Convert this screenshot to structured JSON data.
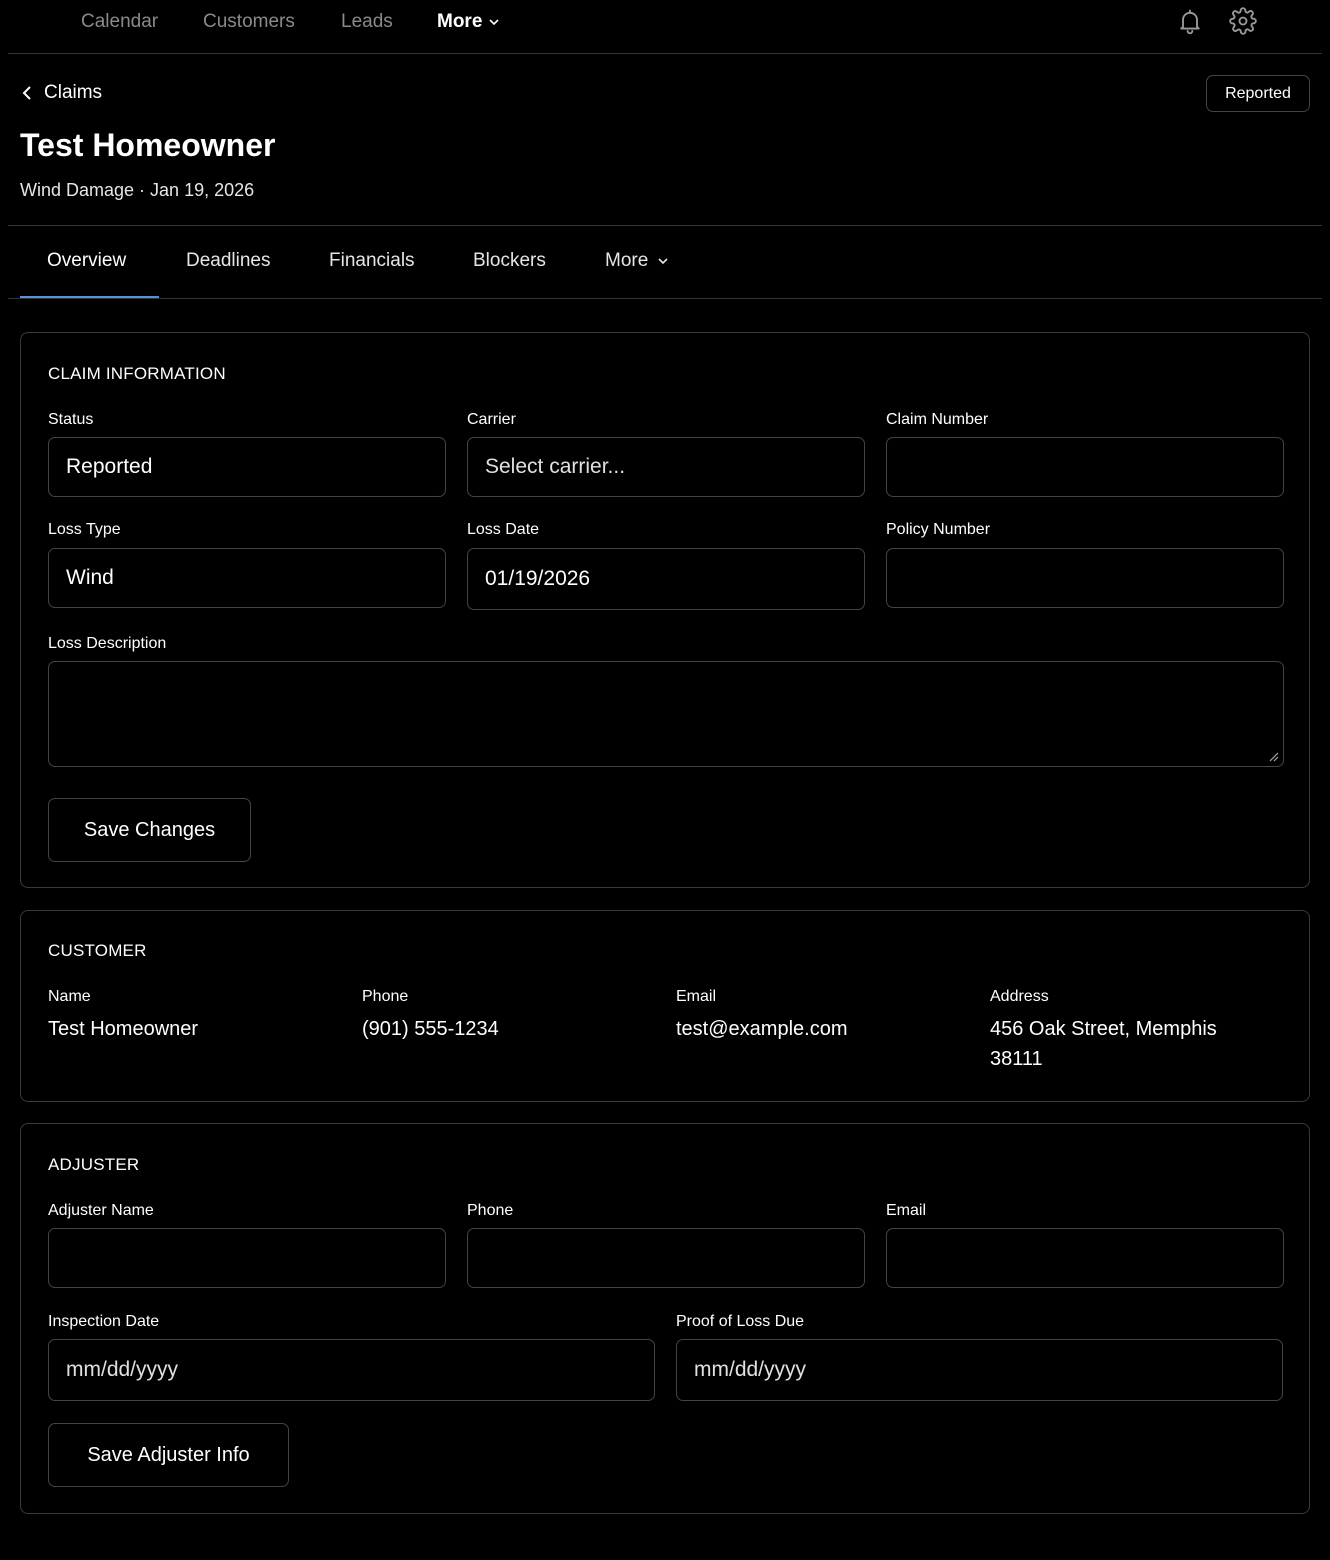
{
  "nav": {
    "links": [
      "Calendar",
      "Customers",
      "Leads"
    ],
    "more_label": "More",
    "icons": [
      "bell-icon",
      "gear-icon"
    ]
  },
  "header": {
    "back_label": "Claims",
    "status_badge": "Reported",
    "title": "Test Homeowner",
    "subtitle": "Wind Damage · Jan 19, 2026"
  },
  "tabs": {
    "items": [
      "Overview",
      "Deadlines",
      "Financials",
      "Blockers",
      "More"
    ],
    "active": "Overview"
  },
  "claim_info": {
    "section_title": "CLAIM INFORMATION",
    "status_label": "Status",
    "status_value": "Reported",
    "carrier_label": "Carrier",
    "carrier_placeholder": "Select carrier...",
    "claim_number_label": "Claim Number",
    "claim_number_value": "",
    "loss_type_label": "Loss Type",
    "loss_type_value": "Wind",
    "loss_date_label": "Loss Date",
    "loss_date_value": "01/19/2026",
    "policy_number_label": "Policy Number",
    "policy_number_value": "",
    "loss_description_label": "Loss Description",
    "loss_description_value": "",
    "save_label": "Save Changes"
  },
  "customer": {
    "section_title": "CUSTOMER",
    "name_label": "Name",
    "name_value": "Test Homeowner",
    "phone_label": "Phone",
    "phone_value": "(901) 555-1234",
    "email_label": "Email",
    "email_value": "test@example.com",
    "address_label": "Address",
    "address_value": "456 Oak Street, Memphis 38111"
  },
  "adjuster": {
    "section_title": "ADJUSTER",
    "name_label": "Adjuster Name",
    "phone_label": "Phone",
    "email_label": "Email",
    "inspection_label": "Inspection Date",
    "inspection_placeholder": "mm/dd/yyyy",
    "proof_label": "Proof of Loss Due",
    "proof_placeholder": "mm/dd/yyyy",
    "save_label": "Save Adjuster Info"
  },
  "colors": {
    "background": "#000000",
    "border": "#3a3a3a",
    "tab_underline": "#5b8fd6",
    "muted_text": "#8a8a8a"
  }
}
